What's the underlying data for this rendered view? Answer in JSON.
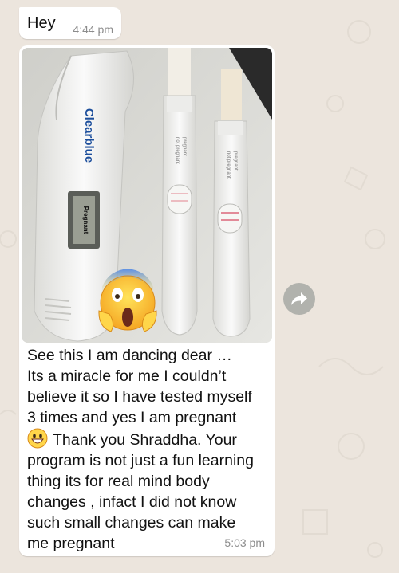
{
  "messages": [
    {
      "text": "Hey",
      "time": "4:44 pm"
    },
    {
      "time": "5:03 pm",
      "photo": {
        "digital_test": {
          "brand": "Clearblue",
          "screen_text": "Pregnant"
        },
        "strip_1": {
          "label_line1": "pregnant",
          "label_line2": "not pregnant"
        },
        "strip_2": {
          "label_line1": "pregnant",
          "label_line2": "not pregnant"
        },
        "overlay_emoji": "face-screaming-in-fear"
      },
      "caption_lines": [
        "See this I am dancing dear …",
        "Its a miracle for me I couldn’t",
        "believe it so I have tested myself",
        "3 times and yes I am pregnant",
        "Thank you Shraddha. Your",
        "program is not just a fun learning",
        "thing its for real mind body",
        "changes , infact I did not know",
        "such small changes can make",
        "me pregnant"
      ],
      "inline_emoji": "grinning-face"
    }
  ],
  "forward_icon": "forward-arrow-icon",
  "colors": {
    "background": "#ece5dd",
    "bubble": "#ffffff",
    "timestamp": "#8c8c8c",
    "forward_button": "#b1b2ad"
  }
}
